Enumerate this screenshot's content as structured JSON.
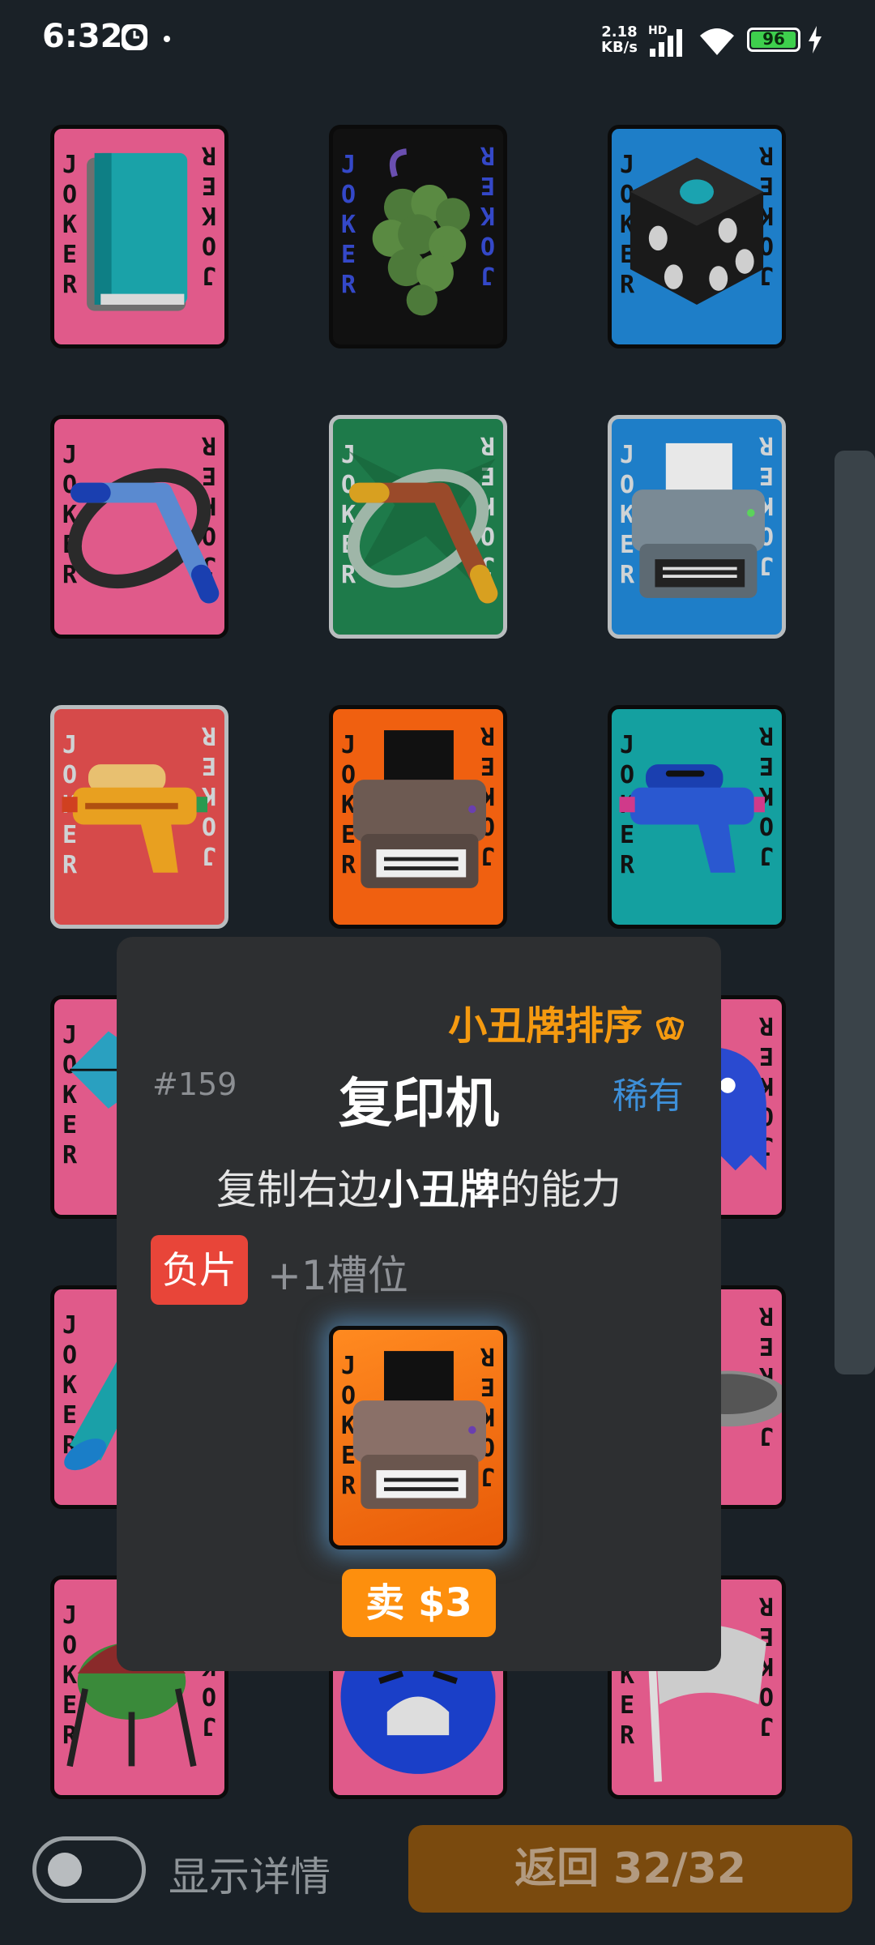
{
  "status_bar": {
    "time": "6:32",
    "net_speed_value": "2.18",
    "net_speed_unit": "KB/s",
    "network_label": "HD",
    "battery": "96",
    "icons": [
      "clock-icon",
      "signal-icon",
      "wifi-icon",
      "battery-icon",
      "charging-icon"
    ]
  },
  "cards": [
    {
      "name": "book",
      "bg": "#e05a8a"
    },
    {
      "name": "grapes",
      "bg": "#111111"
    },
    {
      "name": "dice",
      "bg": "#1e7ec8"
    },
    {
      "name": "boomerang-blue",
      "bg": "#e05a8a"
    },
    {
      "name": "boomerang-brown",
      "bg": "#1e7a4a"
    },
    {
      "name": "printer-blue",
      "bg": "#1e7ec8"
    },
    {
      "name": "water-gun-orange",
      "bg": "#d64a4a"
    },
    {
      "name": "printer-orange",
      "bg": "#f06010"
    },
    {
      "name": "water-gun-blue",
      "bg": "#14a0a0"
    },
    {
      "name": "kite",
      "bg": "#e05a8a"
    },
    {
      "name": "ghost",
      "bg": "#e05a8a"
    },
    {
      "name": "horn",
      "bg": "#e05a8a"
    },
    {
      "name": "plate",
      "bg": "#e05a8a"
    },
    {
      "name": "grill",
      "bg": "#e05a8a"
    },
    {
      "name": "scared-face",
      "bg": "#e05a8a"
    },
    {
      "name": "flag",
      "bg": "#e05a8a"
    }
  ],
  "joker_text": [
    "J",
    "O",
    "K",
    "E",
    "R"
  ],
  "popup": {
    "sort_label": "小丑牌排序",
    "number": "#159",
    "title": "复印机",
    "rarity": "稀有",
    "desc_before": "复制右边",
    "desc_bold": "小丑牌",
    "desc_after": "的能力",
    "edition_badge": "负片",
    "edition_effect": "+1槽位",
    "sell_label": "卖 $3"
  },
  "bottom": {
    "toggle_label": "显示详情",
    "back_label": "返回 32/32"
  },
  "colors": {
    "background": "#1a2127",
    "accent_orange": "#f59a10",
    "rarity_blue": "#3d8fd8",
    "negative_red": "#e84539"
  }
}
